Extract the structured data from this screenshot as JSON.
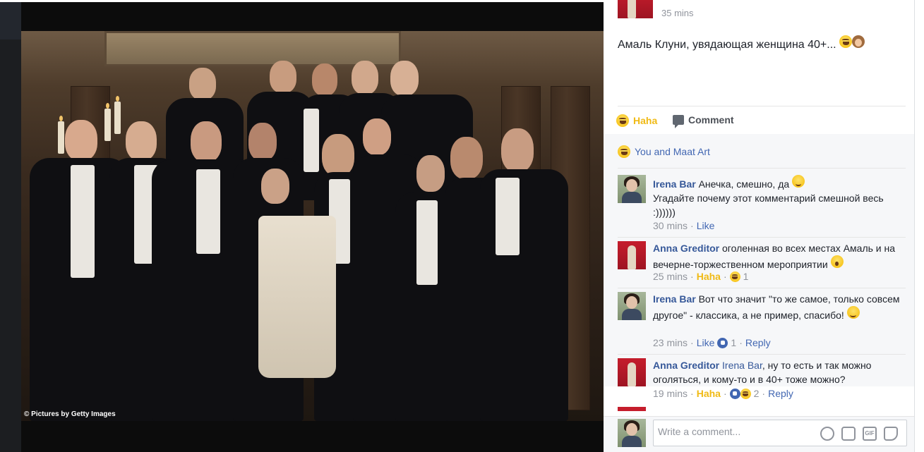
{
  "photo": {
    "credit": "© Pictures by Getty Images"
  },
  "post": {
    "time": "35 mins",
    "text": "Амаль Клуни, увядающая женщина 40+...",
    "actions": {
      "haha_label": "Haha",
      "comment_label": "Comment"
    },
    "reacted_by": "You and Maat Art"
  },
  "comments": [
    {
      "author": "Irena Bar",
      "mention": "",
      "text": "Анечка, смешно, да",
      "text2": "Угадайте почему этот комментарий смешной весь :))))))",
      "time": "30 mins",
      "like_label": "Like",
      "reaction_count": "",
      "reply_label": ""
    },
    {
      "author": "Anna Greditor",
      "mention": "",
      "text": "оголенная во всех местах Амаль и на вечерне-торжественном мероприятии",
      "time": "25 mins",
      "like_label": "Haha",
      "reaction_count": "1",
      "reply_label": ""
    },
    {
      "author": "Irena Bar",
      "mention": "",
      "text": "Вот что значит \"то же самое, только совсем другое\" - классика, а не пример, спасибо!",
      "time": "23 mins",
      "like_label": "Like",
      "reaction_count": "1",
      "reply_label": "Reply"
    },
    {
      "author": "Anna Greditor",
      "mention": "Irena Bar",
      "text": ", ну то есть и так можно оголяться, и кому-то и в 40+ тоже можно?",
      "time": "19 mins",
      "like_label": "Haha",
      "reaction_count": "2",
      "reply_label": "Reply"
    }
  ],
  "composer": {
    "placeholder": "Write a comment..."
  },
  "icons": {
    "haha": "haha-emoji-icon",
    "comment": "comment-bubble-icon",
    "smile": "smile-emoji-icon",
    "wow": "wow-emoji-icon",
    "like": "like-thumb-icon",
    "emoji_picker": "emoji-icon",
    "camera": "camera-icon",
    "gif": "gif-icon",
    "sticker": "sticker-icon"
  },
  "colors": {
    "link": "#365899",
    "haha": "#f0ba15",
    "meta": "#90949c"
  }
}
